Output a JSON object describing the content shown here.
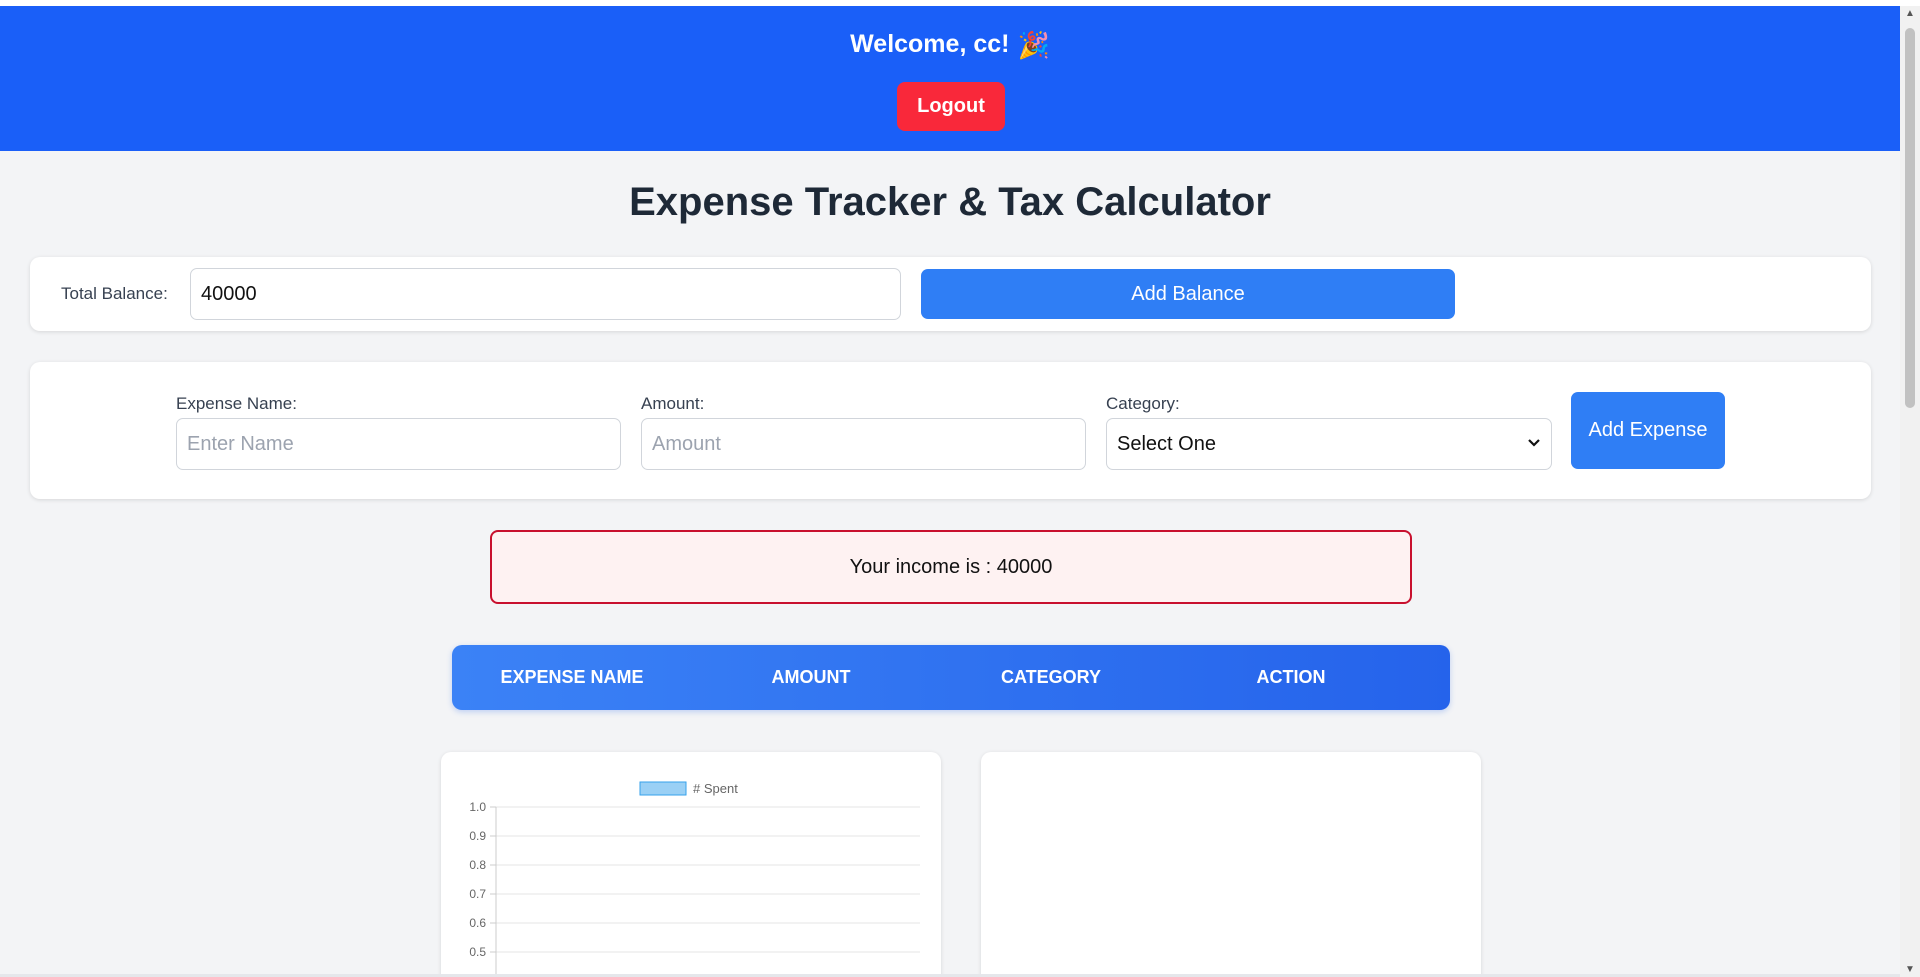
{
  "header": {
    "welcome_text": "Welcome, cc!",
    "party_icon": "🎉",
    "logout_label": "Logout"
  },
  "main": {
    "title": "Expense Tracker & Tax Calculator",
    "balance": {
      "label": "Total Balance:",
      "value": "40000",
      "button_label": "Add Balance"
    },
    "expense_form": {
      "name_label": "Expense Name:",
      "name_placeholder": "Enter Name",
      "amount_label": "Amount:",
      "amount_placeholder": "Amount",
      "category_label": "Category:",
      "category_selected": "Select One",
      "button_label": "Add Expense"
    },
    "income_message": "Your income is : 40000",
    "table": {
      "headers": [
        "EXPENSE NAME",
        "AMOUNT",
        "CATEGORY",
        "ACTION"
      ]
    }
  },
  "colors": {
    "header_bg": "#1a5ff8",
    "logout_bg": "#f9283a",
    "primary_button": "#2f7ef5",
    "alert_border": "#c8102e",
    "alert_bg": "#fef2f2"
  },
  "chart_data": {
    "type": "bar",
    "categories": [],
    "series": [
      {
        "name": "# Spent",
        "values": []
      }
    ],
    "ylim": [
      0,
      1.0
    ],
    "yticks": [
      "1.0",
      "0.9",
      "0.8",
      "0.7",
      "0.6",
      "0.5"
    ],
    "legend": "top",
    "grid": true
  }
}
